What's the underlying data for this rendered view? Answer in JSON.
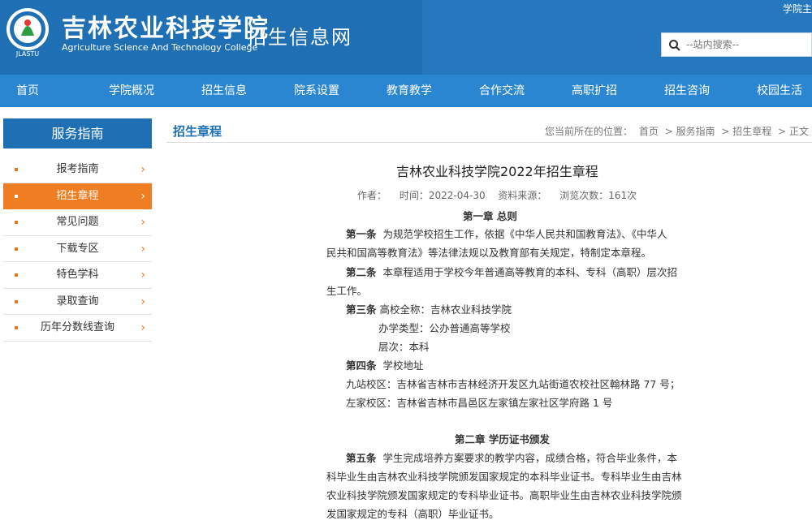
{
  "header": {
    "school_cn": "吉林农业科技学院",
    "school_en": "Agriculture Science And Technology College",
    "site_name": "招生信息网",
    "top_link": "学院主",
    "logo_text": "JLASTU",
    "search_placeholder": "--站内搜索--"
  },
  "nav": [
    "首页",
    "学院概况",
    "招生信息",
    "院系设置",
    "教育教学",
    "合作交流",
    "高职扩招",
    "招生咨询",
    "校园生活"
  ],
  "sidebar": {
    "title": "服务指南",
    "items": [
      {
        "label": "报考指南",
        "active": false
      },
      {
        "label": "招生章程",
        "active": true
      },
      {
        "label": "常见问题",
        "active": false
      },
      {
        "label": "下载专区",
        "active": false
      },
      {
        "label": "特色学科",
        "active": false
      },
      {
        "label": "录取查询",
        "active": false
      },
      {
        "label": "历年分数线查询",
        "active": false
      }
    ]
  },
  "main": {
    "section_title": "招生章程",
    "breadcrumb": {
      "prefix": "您当前所在的位置：",
      "items": [
        "首页",
        "> 服务指南",
        "> 招生章程",
        "> 正文"
      ]
    }
  },
  "article": {
    "title": "吉林农业科技学院2022年招生章程",
    "meta": {
      "author_label": "作者：",
      "time": "时间：2022-04-30",
      "source_label": "资料来源：",
      "views": "浏览次数：161次"
    },
    "chapter1": "第一章  总则",
    "art1_label": "第一条",
    "art1_l1": "为规范学校招生工作，依据《中华人民共和国教育法》、《中华人",
    "art1_l2": "民共和国高等教育法》等法律法规以及教育部有关规定，特制定本章程。",
    "art2_label": "第二条",
    "art2_l1": "本章程适用于学校今年普通高等教育的本科、专科（高职）层次招",
    "art2_l2": "生工作。",
    "art3_label": "第三条",
    "art3_l1": "高校全称：吉林农业科技学院",
    "art3_l2": "办学类型：公办普通高等学校",
    "art3_l3": "层次：本科",
    "art4_label": "第四条",
    "art4_l1": "学校地址",
    "campus1": "九站校区：吉林省吉林市吉林经济开发区九站街道农校社区翰林路 77 号；",
    "campus2": "左家校区：吉林省吉林市昌邑区左家镇左家社区学府路 1 号",
    "chapter2": "第二章  学历证书颁发",
    "art5_label": "第五条",
    "art5_l1": "学生完成培养方案要求的教学内容，成绩合格，符合毕业条件，本",
    "art5_l2": "科毕业生由吉林农业科技学院颁发国家规定的本科毕业证书。专科毕业生由吉林",
    "art5_l3": "农业科技学院颁发国家规定的专科毕业证书。高职毕业生由吉林农业科技学院颁",
    "art5_l4": "发国家规定的专科（高职）毕业证书。"
  },
  "colors": {
    "header_blue": "#1f6fb5",
    "nav_blue": "#2a86d0",
    "accent_orange": "#ef7d22"
  }
}
